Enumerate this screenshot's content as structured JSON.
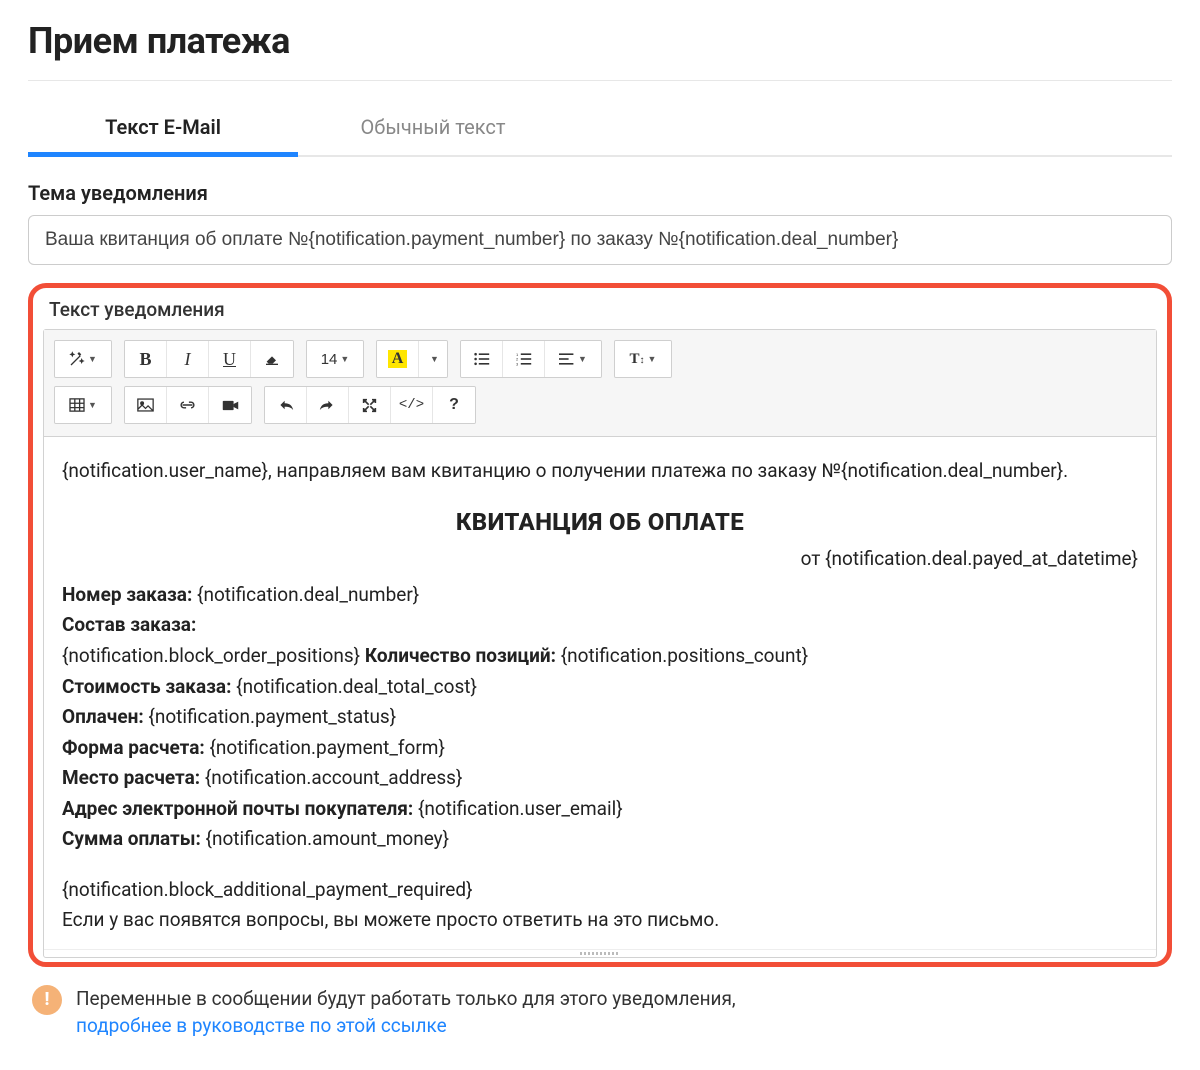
{
  "page": {
    "title": "Прием платежа"
  },
  "tabs": {
    "email": "Текст E-Mail",
    "plain": "Обычный текст"
  },
  "subject": {
    "label": "Тема уведомления",
    "value": "Ваша квитанция об оплате №{notification.payment_number} по заказу №{notification.deal_number}"
  },
  "body": {
    "label": "Текст уведомления"
  },
  "toolbar": {
    "font_size": "14"
  },
  "content": {
    "intro": "{notification.user_name}, направляем вам квитанцию о получении платежа по заказу №{notification.deal_number}.",
    "receipt_title": "КВИТАНЦИЯ ОБ ОПЛАТЕ",
    "date_prefix": "от ",
    "date_value": "{notification.deal.payed_at_datetime}",
    "labels": {
      "order_number": "Номер заказа:",
      "order_content": "Состав заказа:",
      "positions_count": "Количество позиций:",
      "order_cost": "Стоимость заказа:",
      "paid": "Оплачен:",
      "payment_form": "Форма расчета:",
      "payment_place": "Место расчета:",
      "buyer_email": "Адрес электронной почты покупателя:",
      "payment_amount": "Сумма оплаты:"
    },
    "values": {
      "order_number": "{notification.deal_number}",
      "order_positions": "{notification.block_order_positions}",
      "positions_count": "{notification.positions_count}",
      "order_cost": "{notification.deal_total_cost}",
      "paid": "{notification.payment_status}",
      "payment_form": "{notification.payment_form}",
      "payment_place": "{notification.account_address}",
      "buyer_email": "{notification.user_email}",
      "payment_amount": "{notification.amount_money}"
    },
    "additional_block": "{notification.block_additional_payment_required}",
    "outro": "Если у вас появятся вопросы, вы можете просто ответить на это письмо."
  },
  "info": {
    "text": "Переменные в сообщении будут работать только для этого уведомления,",
    "link_text": "подробнее в руководстве по этой ссылке"
  }
}
